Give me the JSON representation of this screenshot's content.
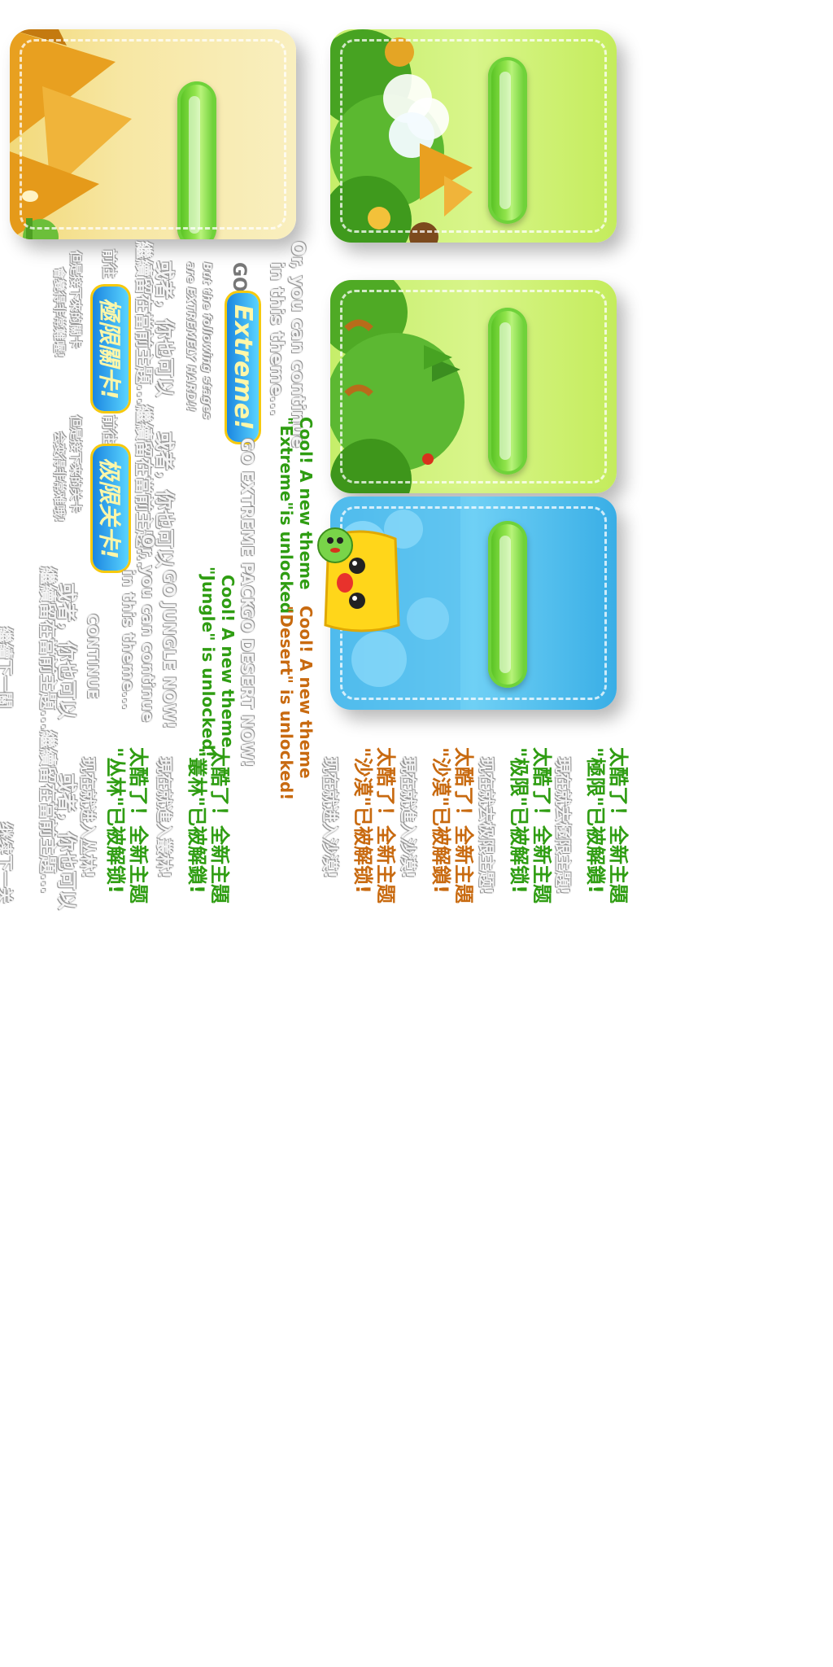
{
  "cards": {
    "desert": {
      "theme": "desert",
      "colors": {
        "base": "#f5e6a0",
        "accent": "#e9a826"
      }
    },
    "jungle_mix": {
      "theme": "jungle-mix",
      "colors": {
        "base": "#d2f27e",
        "accent": "#4aa520"
      }
    },
    "jungle": {
      "theme": "jungle",
      "colors": {
        "base": "#d2f27e",
        "accent": "#4aa520"
      }
    },
    "water": {
      "theme": "water",
      "colors": {
        "base": "#56c4f2",
        "accent": "#1d8fd6"
      }
    }
  },
  "en_texts": {
    "or_continue_1": "Or, you can continue",
    "or_continue_2": "in this theme...",
    "go_extreme": "GO",
    "go_extreme_logo": "Extreme!",
    "but_following": "But the following stages",
    "are_extremely": "are EXTREMELY HARD!!",
    "cool_new_theme_green": "Cool! A new theme",
    "extreme_unlocked": "\"Extreme\"is unlocked!",
    "cool_new_theme_orange": "Cool! A new theme",
    "desert_unlocked": "\"Desert\" is unlocked!",
    "go_extreme_pack": "GO EXTREME PACK",
    "go_desert_now": "GO DESERT NOW!",
    "cool_new_theme_jungle": "Cool! A new theme",
    "jungle_unlocked": "\"Jungle\" is unlocked!",
    "go_jungle_now": "GO JUNGLE NOW!",
    "or_continue_3": "Or, you can continue",
    "or_continue_4": "in this theme...",
    "continue": "CONTINUE"
  },
  "zh_texts": {
    "or_trad": "或者，你也可以",
    "continue_trad": "繼續留在當前主題...繼續留在當前主題...",
    "or_trad_2": "或者，你也可以",
    "continue_mixed": "繼續留在當前主題...繼續留在當前主題...",
    "front_trad": "前往",
    "extreme_logo_trad": "極限關卡!",
    "warn_trad_1": "但是接下來的關卡",
    "warn_trad_2": "會變得非常難喔!",
    "front_simp": "前往",
    "extreme_logo_simp": "极限关卡!",
    "warn_simp_1": "但是接下来的关卡",
    "warn_simp_2": "会变得非常难哦!",
    "cool_trad_jungle": "太酷了！全新主題",
    "jungle_unlocked_trad": "\"叢林\"已被解鎖!",
    "cool_simp_jungle": "太酷了！全新主题",
    "jungle_unlocked_simp": "\"丛林\"已被解锁!",
    "enter_jungle_trad": "現在就進入叢林!",
    "enter_jungle_simp": "现在就进入丛林!",
    "or_simp": "或者，你也可以",
    "continue_simp": "继续留在当前主题...",
    "next_trad": "繼續下一關",
    "next_simp": "继续下一关",
    "cool_trad_extreme": "太酷了！全新主題",
    "extreme_unlocked_trad": "\"極限\"已被解鎖!",
    "go_extreme_trad": "現在就去極限主題!",
    "cool_simp_extreme": "太酷了！全新主题",
    "extreme_unlocked_simp": "\"极限\"已被解锁!",
    "go_extreme_simp": "现在就去极限主题!",
    "cool_trad_desert": "太酷了！全新主題",
    "desert_unlocked_trad": "\"沙漠\"已被解鎖!",
    "enter_desert_trad": "現在就進入沙漠!",
    "cool_simp_desert": "太酷了！全新主题",
    "desert_unlocked_simp": "\"沙漠\"已被解锁!",
    "enter_desert_simp": "现在就进入沙漠!"
  }
}
